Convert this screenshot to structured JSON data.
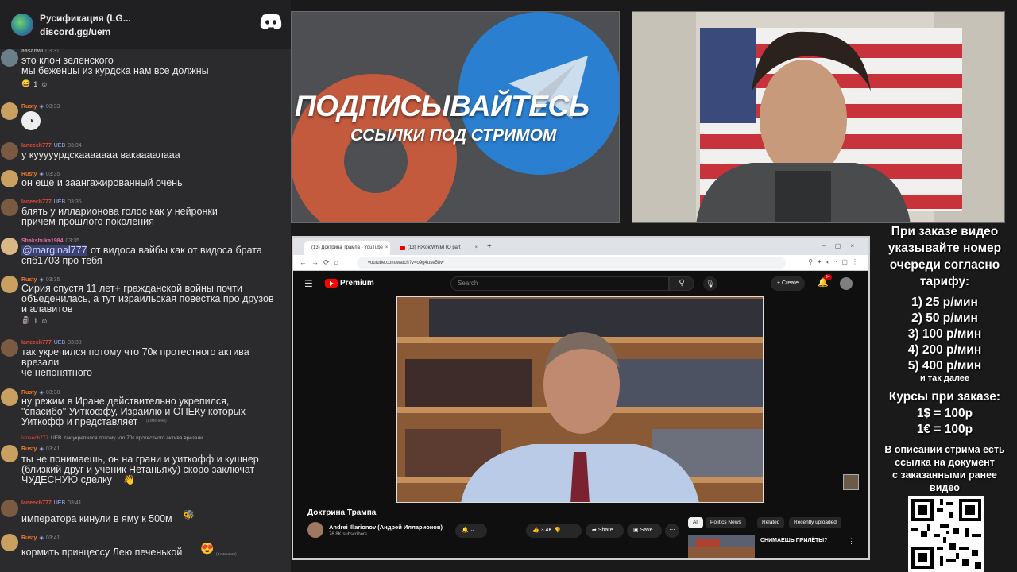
{
  "discord": {
    "server_name": "Русификация (LG...",
    "invite": "discord.gg/uem"
  },
  "chat": [
    {
      "user": "aasanwi",
      "badge": "",
      "time": "03:31",
      "text": "это клон зеленского\nмы беженцы из курдска нам все должны",
      "reaction": "1"
    },
    {
      "user": "Rusty",
      "badge": "",
      "time": "03:33",
      "text": "",
      "emoji": "monocle-face-icon"
    },
    {
      "user": "Ianeech777",
      "badge": "UEB",
      "time": "03:34",
      "text": "у кууууурдскааааааа вакаааалааа"
    },
    {
      "user": "Rusty",
      "badge": "",
      "time": "03:35",
      "text": "он еще и заангажированный очень"
    },
    {
      "user": "Ianeech777",
      "badge": "UEB",
      "time": "03:35",
      "text": "блять у илларионова голос как у нейронки\nпричем прошлого поколения"
    },
    {
      "user": "Shakshuka1984",
      "badge": "",
      "time": "03:35",
      "mention": "@marginal777",
      "text": " от видоса вайбы как от видоса брата\nспб1703 про тебя"
    },
    {
      "user": "Rusty",
      "badge": "",
      "time": "03:35",
      "text": "Сирия спустя 11 лет+ гражданской войны почти\nобъеденилась, а тут израильская повестка про друзов\nи алавитов",
      "reaction": "1"
    },
    {
      "user": "Ianeech777",
      "badge": "UEB",
      "time": "03:38",
      "text": "так укрепился потому что 70к протестного актива\nврезали\nче непонятного"
    },
    {
      "user": "Rusty",
      "badge": "",
      "time": "03:38",
      "text": "ну режим в Иране действительно укрепился,\n\"спасибо\" Уиткоффу, Израилю и ОПЕКу которых\nУиткофф и представляет",
      "edited": "(изменено)"
    },
    {
      "reply_user": "Ianeech777",
      "reply_badge": "UEB",
      "reply_text": "так укрепился потому что 70к протестного актива врезали",
      "user": "Rusty",
      "badge": "",
      "time": "03:41",
      "text": "ты не понимаешь, он на грани и уиткофф и кушнер\n(близкий друг и ученик Нетаньяху) скоро заключат\nЧУДЕСНУЮ сделку"
    },
    {
      "user": "Ianeech777",
      "badge": "UEB",
      "time": "03:41",
      "text": "императора кинули в яму к 500м"
    },
    {
      "user": "Rusty",
      "badge": "",
      "time": "03:41",
      "text": "кормить принцессу Лею печенькой",
      "edited": "(изменено)"
    }
  ],
  "promo": {
    "line1": "ПОДПИСЫВАЙТЕСЬ",
    "line2": "ССЫЛКИ ПОД СТРИМОМ"
  },
  "browser": {
    "tab1": "(13) Доктрина Трампа - YouTube",
    "tab2": "(13) НЖоюWhIмITO part",
    "new_tab": "+",
    "url": "youtube.com/watch?v=o9g4use58w"
  },
  "youtube": {
    "logo_text": "Premium",
    "search_placeholder": "Search",
    "create_label": "+ Create",
    "notif_count": "9+",
    "video_title": "Доктрина Трампа",
    "channel_name": "Andrei Illarionov (Андрей Илларионов)",
    "subscribers": "76.8K subscribers",
    "likes": "3.4K",
    "share": "Share",
    "save": "Save",
    "chips": [
      "All",
      "Politics News",
      "Related",
      "Recently uploaded"
    ],
    "rec_title": "СНИМАЕШЬ ПРИЛЁТЫ?"
  },
  "prices": {
    "intro": [
      "При заказе видео",
      "указывайте номер",
      "очереди согласно",
      "тарифу:"
    ],
    "tiers": [
      "1) 25 р/мин",
      "2) 50 р/мин",
      "3) 100 р/мин",
      "4) 200 р/мин",
      "5) 400 р/мин"
    ],
    "etc": "и так далее",
    "rates_title": "Курсы при заказе:",
    "rates": [
      "1$ = 100р",
      "1€ = 100р"
    ],
    "outro": [
      "В описании стрима есть",
      "ссылка на документ",
      "с заказанными ранее",
      "видео"
    ]
  }
}
